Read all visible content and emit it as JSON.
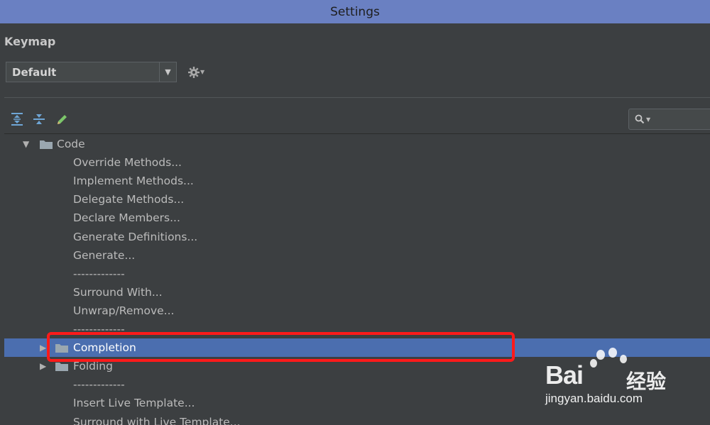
{
  "window": {
    "title": "Settings"
  },
  "panel": {
    "section_title": "Keymap"
  },
  "keymap_select": {
    "value": "Default"
  },
  "toolbar": {
    "icons": [
      "expand-all-icon",
      "collapse-all-icon",
      "edit-icon"
    ]
  },
  "search": {
    "icon": "search-icon",
    "value": ""
  },
  "tree": {
    "rows": [
      {
        "label": "Code",
        "type": "folder",
        "expanded": true
      },
      {
        "label": "Override Methods...",
        "type": "action"
      },
      {
        "label": "Implement Methods...",
        "type": "action"
      },
      {
        "label": "Delegate Methods...",
        "type": "action"
      },
      {
        "label": "Declare Members...",
        "type": "action"
      },
      {
        "label": "Generate Definitions...",
        "type": "action"
      },
      {
        "label": "Generate...",
        "type": "action"
      },
      {
        "label": "-------------",
        "type": "separator"
      },
      {
        "label": "Surround With...",
        "type": "action"
      },
      {
        "label": "Unwrap/Remove...",
        "type": "action"
      },
      {
        "label": "-------------",
        "type": "separator"
      },
      {
        "label": "Completion",
        "type": "folder",
        "expanded": false,
        "selected": true
      },
      {
        "label": "Folding",
        "type": "folder",
        "expanded": false
      },
      {
        "label": "-------------",
        "type": "separator"
      },
      {
        "label": "Insert Live Template...",
        "type": "action"
      },
      {
        "label": "Surround with Live Template...",
        "type": "action"
      }
    ]
  },
  "watermark": {
    "brand": "Bai",
    "brand_cn": "经验",
    "url": "jingyan.baidu.com"
  },
  "colors": {
    "title_bar": "#6a80c2",
    "selected_row": "#4b6eaf",
    "highlight": "#ff1a1a",
    "background": "#3c3f41"
  }
}
